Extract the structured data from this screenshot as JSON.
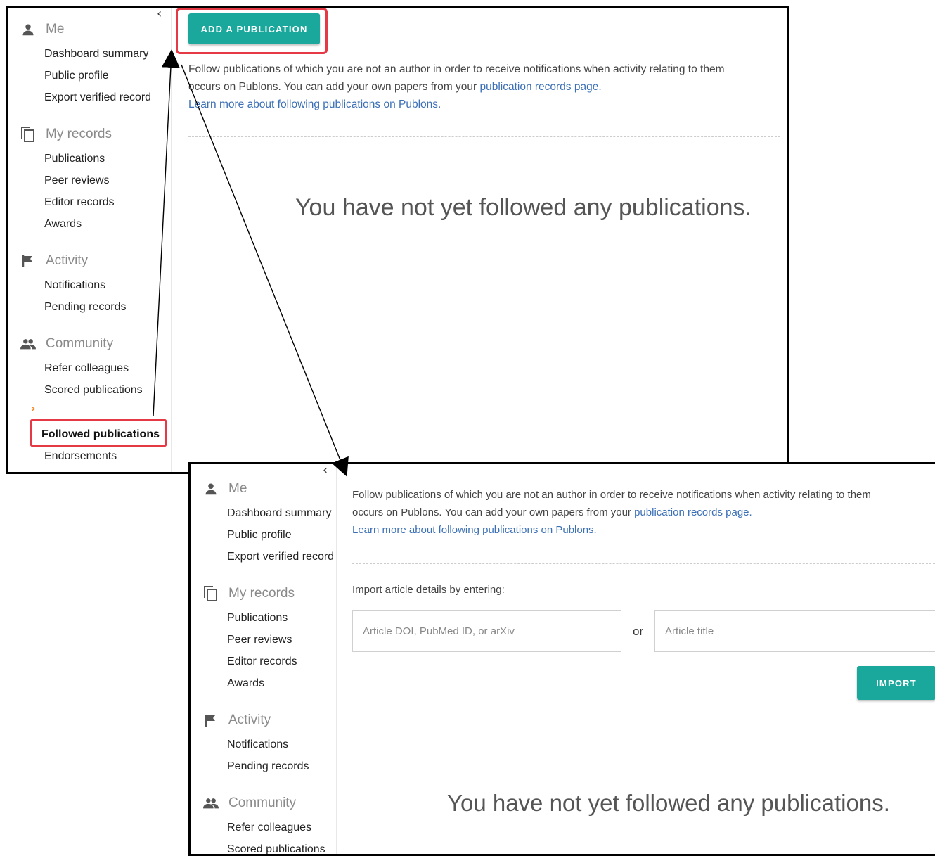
{
  "sidebar": {
    "collapse_chevron": "‹",
    "active_marker": "›",
    "sections": [
      {
        "title": "Me",
        "icon": "person-icon",
        "items": [
          "Dashboard summary",
          "Public profile",
          "Export verified record"
        ]
      },
      {
        "title": "My records",
        "icon": "copy-icon",
        "items": [
          "Publications",
          "Peer reviews",
          "Editor records",
          "Awards"
        ]
      },
      {
        "title": "Activity",
        "icon": "flag-icon",
        "items": [
          "Notifications",
          "Pending records"
        ]
      },
      {
        "title": "Community",
        "icon": "people-icon",
        "items": [
          "Refer colleagues",
          "Scored publications",
          "Followed publications",
          "Endorsements"
        ]
      }
    ],
    "active_item": "Followed publications"
  },
  "main": {
    "add_button": "ADD A PUBLICATION",
    "info_line1": "Follow publications of which you are not an author in order to receive notifications when activity relating to them",
    "info_line2_prefix": "occurs on Publons. You can add your own papers from your ",
    "info_line2_link": "publication records page.",
    "info_line3_link": "Learn more about following publications on Publons.",
    "empty_message": "You have not yet followed any publications.",
    "import_label": "Import article details by entering:",
    "doi_placeholder": "Article DOI, PubMed ID, or arXiv",
    "or_label": "or",
    "title_placeholder": "Article title",
    "import_button": "IMPORT"
  },
  "colors": {
    "accent": "#1aa89c",
    "highlight": "#e53945",
    "active_marker": "#f08c2c",
    "link": "#3b6fb6"
  }
}
